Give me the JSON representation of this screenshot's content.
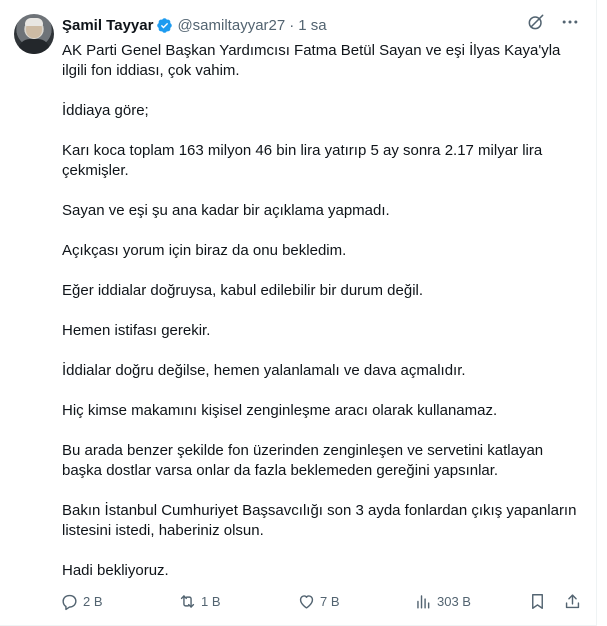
{
  "author": {
    "name": "Şamil Tayyar",
    "handle": "@samiltayyar27",
    "separator": "·",
    "time": "1 sa",
    "verified": true
  },
  "icons": {
    "grok": "grok-icon",
    "more": "more-icon",
    "verified": "verified-badge-icon",
    "reply": "reply-icon",
    "retweet": "retweet-icon",
    "like": "like-icon",
    "views": "views-icon",
    "bookmark": "bookmark-icon",
    "share": "share-icon"
  },
  "colors": {
    "verified": "#1d9bf0",
    "text": "#0f1419",
    "secondary": "#536471"
  },
  "tweet": {
    "paragraphs": [
      "AK Parti Genel Başkan Yardımcısı Fatma Betül Sayan ve eşi İlyas Kaya'yla ilgili fon iddiası, çok vahim.",
      "İddiaya göre;",
      "Karı koca toplam 163 milyon 46 bin lira yatırıp 5 ay sonra 2.17 milyar lira çekmişler.",
      "Sayan ve eşi şu ana kadar bir açıklama yapmadı.",
      "Açıkçası yorum için biraz da onu bekledim.",
      "Eğer iddialar doğruysa, kabul edilebilir bir durum değil.",
      "Hemen istifası gerekir.",
      "İddialar doğru değilse, hemen yalanlamalı ve dava açmalıdır.",
      "Hiç kimse makamını kişisel zenginleşme aracı olarak kullanamaz.",
      "Bu arada benzer şekilde fon üzerinden zenginleşen ve servetini katlayan başka dostlar varsa onlar da fazla beklemeden gereğini yapsınlar.",
      "Bakın İstanbul Cumhuriyet Başsavcılığı son 3 ayda fonlardan çıkış yapanların listesini istedi, haberiniz olsun.",
      "Hadi bekliyoruz."
    ]
  },
  "stats": {
    "replies": "2 B",
    "retweets": "1 B",
    "likes": "7 B",
    "views": "303 B"
  }
}
